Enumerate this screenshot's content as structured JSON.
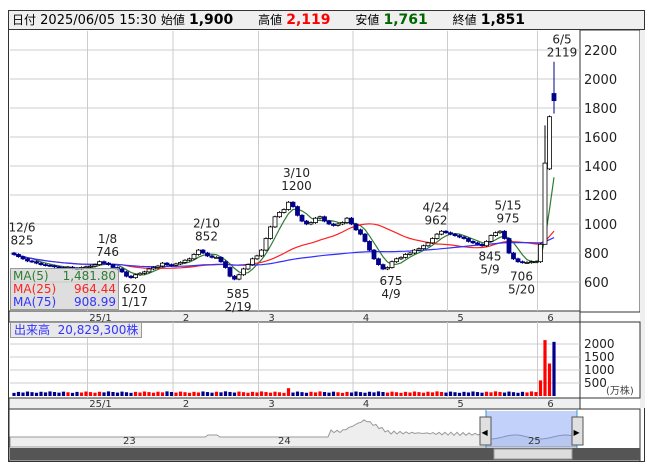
{
  "header": {
    "date_label": "日付",
    "datetime": "2025/06/05 15:30",
    "open_label": "始値",
    "open": "1,900",
    "high_label": "高値",
    "high": "2,119",
    "low_label": "安値",
    "low": "1,761",
    "close_label": "終値",
    "close": "1,851"
  },
  "ma_legend": [
    {
      "label": "MA(5)",
      "value": "1,481.80",
      "color": "#2e7d32"
    },
    {
      "label": "MA(25)",
      "value": "964.44",
      "color": "#ff2020"
    },
    {
      "label": "MA(75)",
      "value": "908.99",
      "color": "#3030ff"
    }
  ],
  "volume_label": {
    "label": "出来高",
    "value": "20,829,300株"
  },
  "navigator": {
    "labels": [
      "23",
      "24",
      "25"
    ]
  },
  "chart_data": {
    "type": "candlestick",
    "ylim": [
      400,
      2300
    ],
    "yticks": [
      "2200",
      "2000",
      "1800",
      "1600",
      "1400",
      "1200",
      "1000",
      "800",
      "600"
    ],
    "month_labels": [
      {
        "label": "25/1",
        "index": 17
      },
      {
        "label": "2",
        "index": 36
      },
      {
        "label": "3",
        "index": 55
      },
      {
        "label": "4",
        "index": 76
      },
      {
        "label": "5",
        "index": 97
      },
      {
        "label": "6",
        "index": 117
      }
    ],
    "closes": [
      790,
      775,
      760,
      745,
      740,
      730,
      720,
      715,
      712,
      705,
      700,
      698,
      702,
      695,
      690,
      700,
      705,
      710,
      720,
      740,
      730,
      720,
      700,
      690,
      670,
      640,
      630,
      650,
      660,
      670,
      690,
      700,
      710,
      730,
      720,
      715,
      725,
      735,
      750,
      760,
      790,
      820,
      800,
      780,
      770,
      770,
      740,
      700,
      640,
      620,
      650,
      690,
      720,
      760,
      780,
      820,
      900,
      980,
      1050,
      1080,
      1100,
      1150,
      1120,
      1060,
      1020,
      1000,
      1010,
      1040,
      1050,
      1020,
      1000,
      990,
      1000,
      1010,
      1040,
      1000,
      960,
      930,
      880,
      820,
      760,
      720,
      690,
      700,
      740,
      760,
      770,
      790,
      800,
      820,
      830,
      850,
      870,
      900,
      930,
      950,
      940,
      930,
      920,
      910,
      900,
      880,
      870,
      860,
      850,
      880,
      920,
      940,
      950,
      900,
      800,
      760,
      740,
      735,
      735,
      740,
      740,
      860,
      1420,
      1740,
      1851
    ],
    "last_candle": {
      "open": 1900,
      "high": 2119,
      "low": 1761,
      "close": 1851
    },
    "volume_unit": "(万株)",
    "volume_ticks": [
      "2000",
      "1500",
      "1000",
      "500"
    ],
    "volume_ylim": [
      0,
      2300
    ],
    "volumes_last": [
      {
        "index": 117,
        "value": 600
      },
      {
        "index": 118,
        "value": 2150
      },
      {
        "index": 119,
        "value": 1250
      },
      {
        "index": 120,
        "value": 2083
      }
    ],
    "volume_base": 120,
    "annotations": [
      {
        "date": "12/6",
        "value": "825",
        "index": 0,
        "pos": "above",
        "price": 825
      },
      {
        "date": "1/8",
        "value": "746",
        "index": 19,
        "pos": "above",
        "price": 746
      },
      {
        "date": "1/17",
        "value": "620",
        "index": 25,
        "pos": "below",
        "price": 620
      },
      {
        "date": "2/10",
        "value": "852",
        "index": 41,
        "pos": "above",
        "price": 852
      },
      {
        "date": "2/19",
        "value": "585",
        "index": 48,
        "pos": "below",
        "price": 585
      },
      {
        "date": "3/10",
        "value": "1200",
        "index": 61,
        "pos": "above",
        "price": 1200
      },
      {
        "date": "4/9",
        "value": "675",
        "index": 82,
        "pos": "below",
        "price": 675
      },
      {
        "date": "4/24",
        "value": "962",
        "index": 92,
        "pos": "above",
        "price": 962
      },
      {
        "date": "5/9",
        "value": "845",
        "index": 104,
        "pos": "below",
        "price": 845
      },
      {
        "date": "5/15",
        "value": "975",
        "index": 108,
        "pos": "above",
        "price": 975
      },
      {
        "date": "5/20",
        "value": "706",
        "index": 111,
        "pos": "below",
        "price": 706
      },
      {
        "date": "6/5",
        "value": "2119",
        "index": 120,
        "pos": "above",
        "price": 2119
      }
    ]
  }
}
